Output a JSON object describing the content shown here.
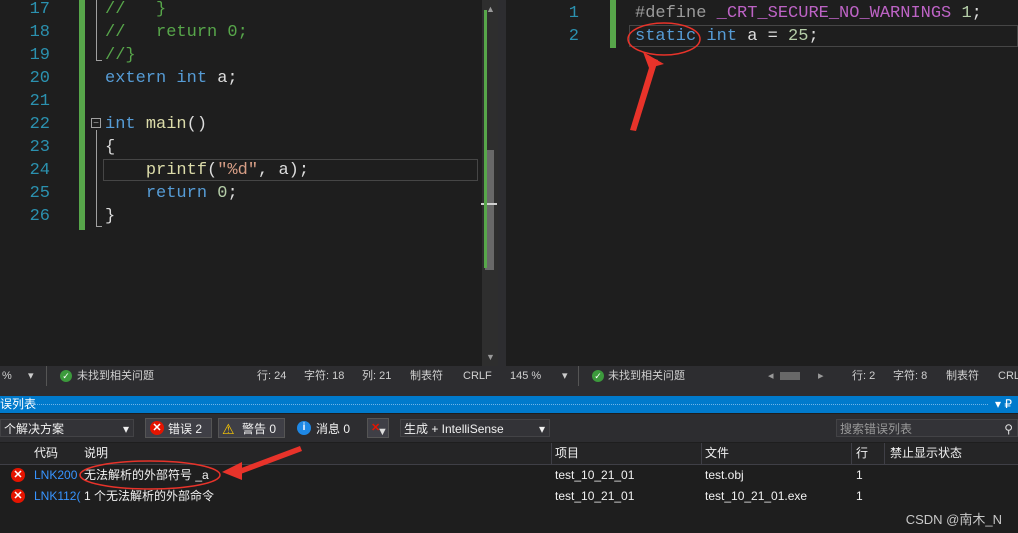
{
  "left_editor": {
    "lines": [
      {
        "num": "17",
        "tokens": [
          {
            "t": "//   }",
            "c": "cm"
          }
        ]
      },
      {
        "num": "18",
        "tokens": [
          {
            "t": "//   return 0;",
            "c": "cm"
          }
        ]
      },
      {
        "num": "19",
        "tokens": [
          {
            "t": "//}",
            "c": "cm"
          }
        ]
      },
      {
        "num": "20",
        "tokens": [
          {
            "t": "extern",
            "c": "kw"
          },
          {
            "t": " ",
            "c": ""
          },
          {
            "t": "int",
            "c": "kw"
          },
          {
            "t": " a;",
            "c": ""
          }
        ]
      },
      {
        "num": "21",
        "tokens": []
      },
      {
        "num": "22",
        "tokens": [
          {
            "t": "int",
            "c": "kw"
          },
          {
            "t": " ",
            "c": ""
          },
          {
            "t": "main",
            "c": "fn"
          },
          {
            "t": "()",
            "c": ""
          }
        ]
      },
      {
        "num": "23",
        "tokens": [
          {
            "t": "{",
            "c": ""
          }
        ]
      },
      {
        "num": "24",
        "tokens": [
          {
            "t": "    ",
            "c": ""
          },
          {
            "t": "printf",
            "c": "fn"
          },
          {
            "t": "(",
            "c": ""
          },
          {
            "t": "\"%d\"",
            "c": "str"
          },
          {
            "t": ", a);",
            "c": ""
          }
        ]
      },
      {
        "num": "25",
        "tokens": [
          {
            "t": "    ",
            "c": ""
          },
          {
            "t": "return",
            "c": "kw"
          },
          {
            "t": " ",
            "c": ""
          },
          {
            "t": "0",
            "c": "num"
          },
          {
            "t": ";",
            "c": ""
          }
        ]
      },
      {
        "num": "26",
        "tokens": [
          {
            "t": "}",
            "c": ""
          }
        ]
      }
    ]
  },
  "right_editor": {
    "lines": [
      {
        "num": "1",
        "tokens": [
          {
            "t": "#define",
            "c": "pp"
          },
          {
            "t": " ",
            "c": ""
          },
          {
            "t": "_CRT_SECURE_NO_WARNINGS",
            "c": "mac"
          },
          {
            "t": " ",
            "c": ""
          },
          {
            "t": "1",
            "c": "num"
          },
          {
            "t": ";",
            "c": ""
          }
        ]
      },
      {
        "num": "2",
        "tokens": [
          {
            "t": "static",
            "c": "kw"
          },
          {
            "t": " ",
            "c": ""
          },
          {
            "t": "int",
            "c": "kw"
          },
          {
            "t": " a = ",
            "c": ""
          },
          {
            "t": "25",
            "c": "num"
          },
          {
            "t": ";",
            "c": ""
          }
        ]
      }
    ]
  },
  "left_status": {
    "zoom": "%",
    "issues": "未找到相关问题",
    "line": "行: 24",
    "char": "字符: 18",
    "col": "列: 21",
    "tabs": "制表符",
    "eol": "CRLF"
  },
  "right_status": {
    "zoom": "145 %",
    "issues": "未找到相关问题",
    "line": "行: 2",
    "char": "字符: 8",
    "tabs": "制表符",
    "eol": "CRL"
  },
  "error_list": {
    "title": "误列表",
    "scope": "个解决方案",
    "errors_btn": "错误 2",
    "warnings_btn": "警告 0",
    "messages_btn": "消息 0",
    "build_filter": "生成 + IntelliSense",
    "search_placeholder": "搜索错误列表",
    "pin_label": "▾ ₽",
    "columns": {
      "code": "代码",
      "desc": "说明",
      "project": "项目",
      "file": "文件",
      "line": "行",
      "suppress": "禁止显示状态"
    },
    "rows": [
      {
        "code": "LNK200",
        "desc": "无法解析的外部符号 _a",
        "project": "test_10_21_01",
        "file": "test.obj",
        "line": "1"
      },
      {
        "code": "LNK112(",
        "desc": "1 个无法解析的外部命令",
        "project": "test_10_21_01",
        "file": "test_10_21_01.exe",
        "line": "1"
      }
    ]
  },
  "watermark": "CSDN @南木_N",
  "colors": {
    "annotation_red": "#e8332a",
    "accent_blue": "#007acc"
  }
}
